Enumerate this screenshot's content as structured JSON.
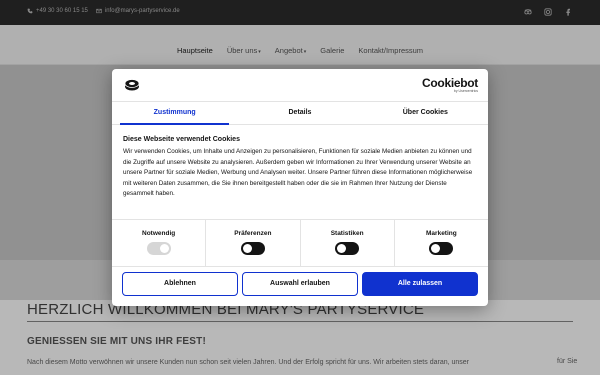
{
  "topbar": {
    "phone": "+49 30 30 60 15 15",
    "email": "info@marys-partyservice.de",
    "social_icons": [
      "tripadvisor-icon",
      "instagram-icon",
      "facebook-icon"
    ]
  },
  "nav": {
    "items": [
      {
        "label": "Hauptseite",
        "active": true,
        "dropdown": false
      },
      {
        "label": "Über uns",
        "active": false,
        "dropdown": true
      },
      {
        "label": "Angebot",
        "active": false,
        "dropdown": true
      },
      {
        "label": "Galerie",
        "active": false,
        "dropdown": false
      },
      {
        "label": "Kontakt/Impressum",
        "active": false,
        "dropdown": false
      }
    ]
  },
  "page": {
    "welcome": "HERZLICH WILLKOMMEN BEI MARY'S PARTYSERVICE",
    "subheading": "GENIESSEN SIE MIT UNS IHR FEST!",
    "body_text": "Nach diesem Motto verwöhnen wir unsere Kunden nun schon seit vielen Jahren. Und der Erfolg spricht für uns. Wir arbeiten stets daran, unser",
    "body_text_end": "für Sie"
  },
  "cookie_dialog": {
    "brand_name": "Cookiebot",
    "brand_byline": "by Usercentrics",
    "tabs": [
      {
        "label": "Zustimmung",
        "active": true
      },
      {
        "label": "Details",
        "active": false
      },
      {
        "label": "Über Cookies",
        "active": false
      }
    ],
    "title": "Diese Webseite verwendet Cookies",
    "text": "Wir verwenden Cookies, um Inhalte und Anzeigen zu personalisieren, Funktionen für soziale Medien anbieten zu können und die Zugriffe auf unsere Website zu analysieren. Außerdem geben wir Informationen zu Ihrer Verwendung unserer Website an unsere Partner für soziale Medien, Werbung und Analysen weiter. Unsere Partner führen diese Informationen möglicherweise mit weiteren Daten zusammen, die Sie ihnen bereitgestellt haben oder die sie im Rahmen Ihrer Nutzung der Dienste gesammelt haben.",
    "toggles": [
      {
        "label": "Notwendig",
        "checked": true,
        "disabled": true
      },
      {
        "label": "Präferenzen",
        "checked": false,
        "disabled": false
      },
      {
        "label": "Statistiken",
        "checked": false,
        "disabled": false
      },
      {
        "label": "Marketing",
        "checked": false,
        "disabled": false
      }
    ],
    "buttons": {
      "deny": "Ablehnen",
      "allow_selection": "Auswahl erlauben",
      "allow_all": "Alle zulassen"
    },
    "colors": {
      "accent": "#1032cf",
      "text": "#141414",
      "toggle_off": "#141414",
      "toggle_disabled": "#d6d6d6"
    }
  }
}
